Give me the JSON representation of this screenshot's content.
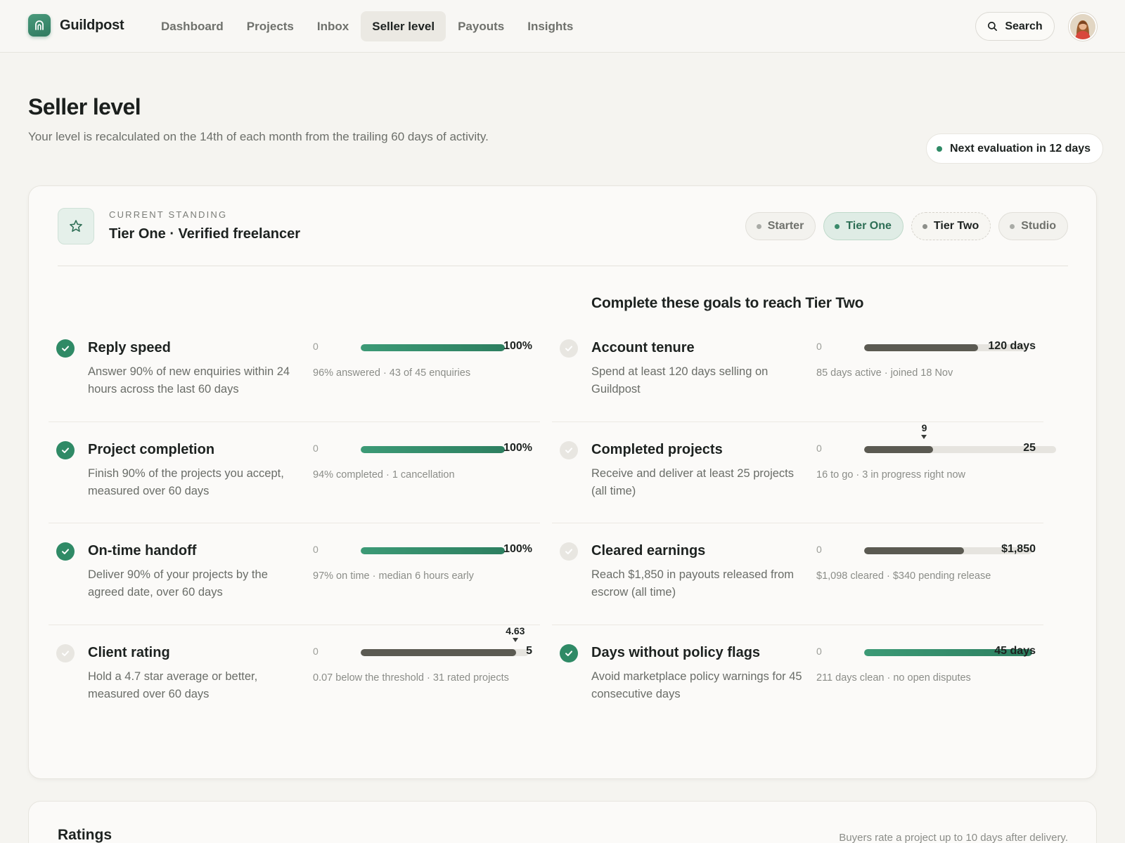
{
  "brand": {
    "name": "Guildpost",
    "logo_icon": "storefront-icon",
    "accent": "#2f8a66"
  },
  "nav": {
    "items": [
      {
        "label": "Dashboard",
        "active": false
      },
      {
        "label": "Projects",
        "active": false
      },
      {
        "label": "Inbox",
        "active": false
      },
      {
        "label": "Seller level",
        "active": true
      },
      {
        "label": "Payouts",
        "active": false
      },
      {
        "label": "Insights",
        "active": false
      }
    ],
    "search_label": "Search",
    "search_icon": "search-icon",
    "avatar_icon": "user-avatar"
  },
  "header": {
    "title": "Seller level",
    "subtitle": "Your level is recalculated on the 14th of each month from the trailing 60 days of activity.",
    "evaluation": "Next evaluation in 12 days"
  },
  "standing": {
    "eyebrow": "CURRENT STANDING",
    "title": "Tier One · Verified freelancer",
    "icon": "star-icon",
    "tiers": [
      {
        "label": "Starter",
        "state": "past"
      },
      {
        "label": "Tier One",
        "state": "current"
      },
      {
        "label": "Tier Two",
        "state": "next"
      },
      {
        "label": "Studio",
        "state": "future"
      }
    ]
  },
  "goals_heading": "Complete these goals to reach Tier Two",
  "criteria_left": [
    {
      "name": "Reply speed",
      "desc": "Answer 90% of new enquiries within 24 hours across the last 60 days",
      "met": true,
      "zero": "0",
      "target": "100%",
      "progress": 1.0,
      "caption": "96% answered · 43 of 45 enquiries"
    },
    {
      "name": "Project completion",
      "desc": "Finish 90% of the projects you accept, measured over 60 days",
      "met": true,
      "zero": "0",
      "target": "100%",
      "progress": 1.0,
      "caption": "94% completed · 1 cancellation"
    },
    {
      "name": "On-time handoff",
      "desc": "Deliver 90% of your projects by the agreed date, over 60 days",
      "met": true,
      "zero": "0",
      "target": "100%",
      "progress": 1.0,
      "caption": "97% on time · median 6 hours early"
    },
    {
      "name": "Client rating",
      "desc": "Hold a 4.7 star average or better, measured over 60 days",
      "met": false,
      "zero": "0",
      "target": "5",
      "progress": 0.926,
      "marker": "4.63",
      "caption": "0.07 below the threshold · 31 rated projects"
    }
  ],
  "criteria_right": [
    {
      "name": "Account tenure",
      "desc": "Spend at least 120 days selling on Guildpost",
      "met": false,
      "zero": "0",
      "target": "120 days",
      "progress": 0.708,
      "caption": "85 days active · joined 18 Nov"
    },
    {
      "name": "Completed projects",
      "desc": "Receive and deliver at least 25 projects (all time)",
      "met": false,
      "zero": "0",
      "target": "25",
      "progress": 0.36,
      "marker": "9",
      "caption": "16 to go · 3 in progress right now"
    },
    {
      "name": "Cleared earnings",
      "desc": "Reach $1,850 in payouts released from escrow (all time)",
      "met": false,
      "zero": "0",
      "target": "$1,850",
      "progress": 0.594,
      "caption": "$1,098 cleared · $340 pending release"
    },
    {
      "name": "Days without policy flags",
      "desc": "Avoid marketplace policy warnings for 45 consecutive days",
      "met": true,
      "zero": "0",
      "target": "45 days",
      "progress": 1.0,
      "caption": "211 days clean · no open disputes"
    }
  ],
  "ratings": {
    "title": "Ratings",
    "note": "Buyers rate a project up to 10 days after delivery."
  }
}
